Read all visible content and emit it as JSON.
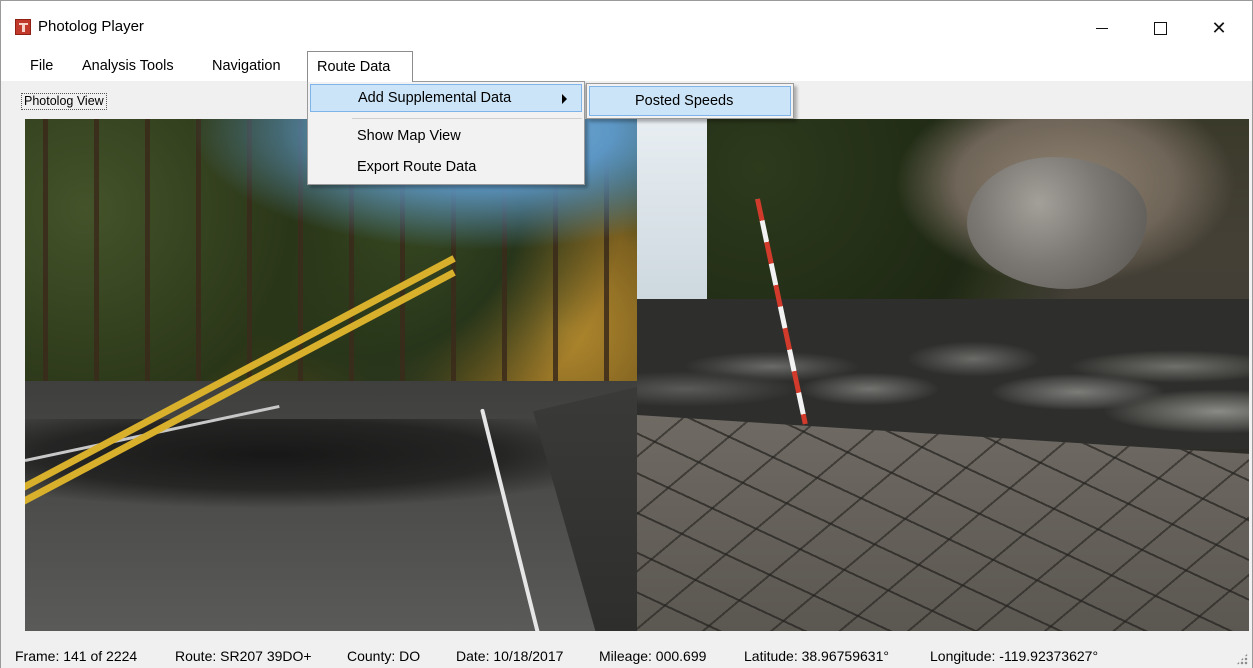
{
  "window": {
    "title": "Photolog Player",
    "icon": "app-icon",
    "controls": {
      "minimize": "minimize-icon",
      "maximize": "maximize-icon",
      "close": "✕"
    }
  },
  "menubar": {
    "items": [
      "File",
      "Analysis Tools",
      "Navigation",
      "Route Data"
    ],
    "open_menu": "Route Data"
  },
  "route_data_menu": {
    "items": [
      {
        "label": "Add Supplemental Data",
        "has_submenu": true,
        "highlighted": true
      },
      {
        "label": "Show Map View"
      },
      {
        "label": "Export Route Data"
      }
    ],
    "submenu": {
      "items": [
        {
          "label": "Posted Speeds",
          "highlighted": true
        }
      ]
    }
  },
  "photolog": {
    "group_label": "Photolog View"
  },
  "status": {
    "frame": "Frame: 141 of 2224",
    "route": "Route: SR207 39DO+",
    "county": "County: DO",
    "date": "Date: 10/18/2017",
    "mileage": "Mileage: 000.699",
    "latitude": "Latitude: 38.96759631°",
    "longitude": "Longitude: -119.92373627°"
  },
  "colors": {
    "menu_highlight": "#cce4f7",
    "menu_highlight_border": "#7eb4ea",
    "window_bg": "#f0f0f0",
    "app_icon": "#c0392b"
  }
}
